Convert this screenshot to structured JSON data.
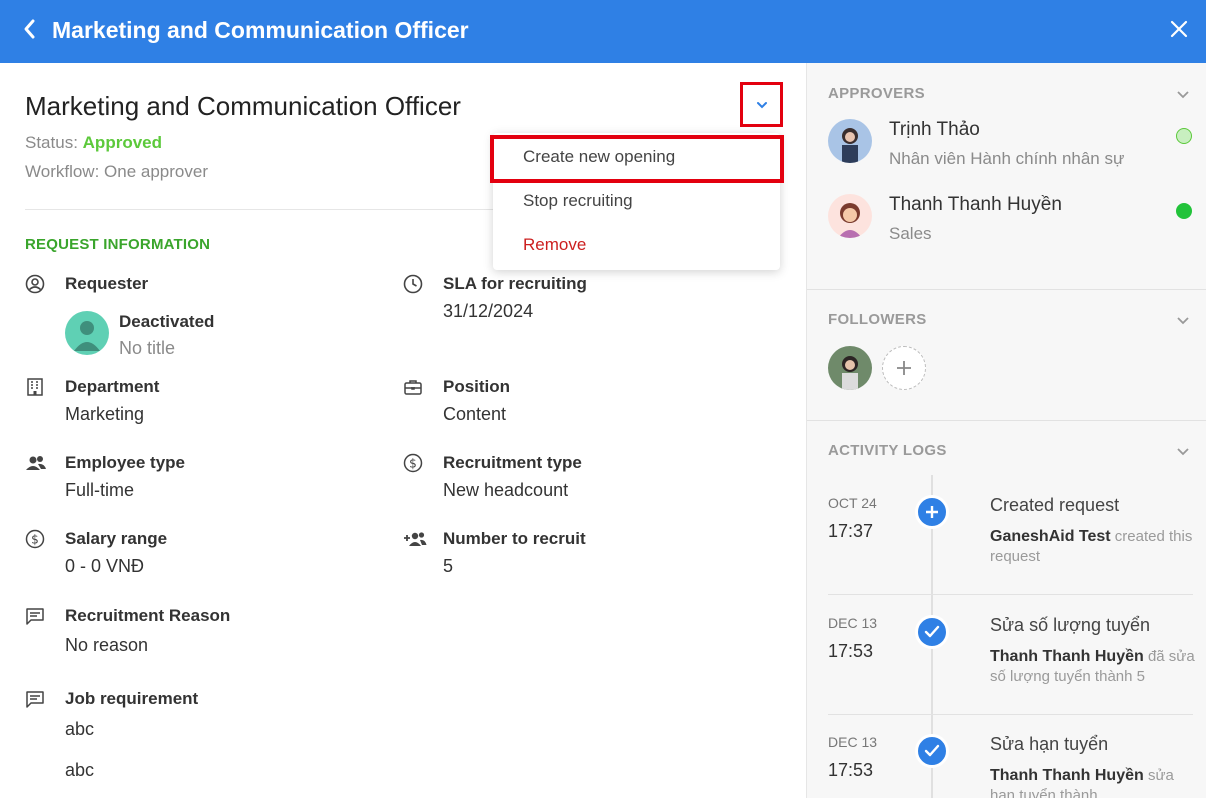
{
  "header": {
    "title": "Marketing and Communication Officer"
  },
  "request": {
    "title": "Marketing and Communication Officer",
    "status_label": "Status:",
    "status_value": "Approved",
    "workflow": "Workflow: One approver"
  },
  "menu": {
    "items": [
      "Create new opening",
      "Stop recruiting",
      "Remove"
    ]
  },
  "section_title": "REQUEST INFORMATION",
  "fields": {
    "requester": {
      "label": "Requester",
      "name": "Deactivated",
      "title": "No title"
    },
    "sla": {
      "label": "SLA for recruiting",
      "value": "31/12/2024"
    },
    "department": {
      "label": "Department",
      "value": "Marketing"
    },
    "position": {
      "label": "Position",
      "value": "Content"
    },
    "employee_type": {
      "label": "Employee type",
      "value": "Full-time"
    },
    "recruitment_type": {
      "label": "Recruitment type",
      "value": "New headcount"
    },
    "salary": {
      "label": "Salary range",
      "value": "0 - 0 VNĐ"
    },
    "number": {
      "label": "Number to recruit",
      "value": "5"
    },
    "reason": {
      "label": "Recruitment Reason",
      "value": "No reason"
    },
    "job_req": {
      "label": "Job requirement",
      "line1": "abc",
      "line2": "abc"
    }
  },
  "approvers": {
    "title": "APPROVERS",
    "items": [
      {
        "name": "Trịnh Thảo",
        "role": "Nhân viên Hành chính nhân sự",
        "status_color": "#c8efc0"
      },
      {
        "name": "Thanh Thanh Huyền",
        "role": "Sales",
        "status_color": "#22c33a"
      }
    ]
  },
  "followers": {
    "title": "FOLLOWERS"
  },
  "activity": {
    "title": "ACTIVITY LOGS",
    "items": [
      {
        "date": "OCT 24",
        "time": "17:37",
        "head": "Created request",
        "actor": "GaneshAid Test",
        "text": "created this request",
        "icon": "plus-icon"
      },
      {
        "date": "DEC 13",
        "time": "17:53",
        "head": "Sửa số lượng tuyển",
        "actor": "Thanh Thanh Huyền",
        "text": "đã sửa số lượng tuyển thành 5",
        "icon": "check-icon"
      },
      {
        "date": "DEC 13",
        "time": "17:53",
        "head": "Sửa hạn tuyển",
        "actor": "Thanh Thanh Huyền",
        "text": "sửa hạn tuyển thành",
        "icon": "check-icon"
      }
    ]
  },
  "colors": {
    "brand": "#2f80e5",
    "approved": "#5cc93b",
    "section": "#3aa52c",
    "danger": "#cc1f1f",
    "highlight": "#e3000f"
  }
}
